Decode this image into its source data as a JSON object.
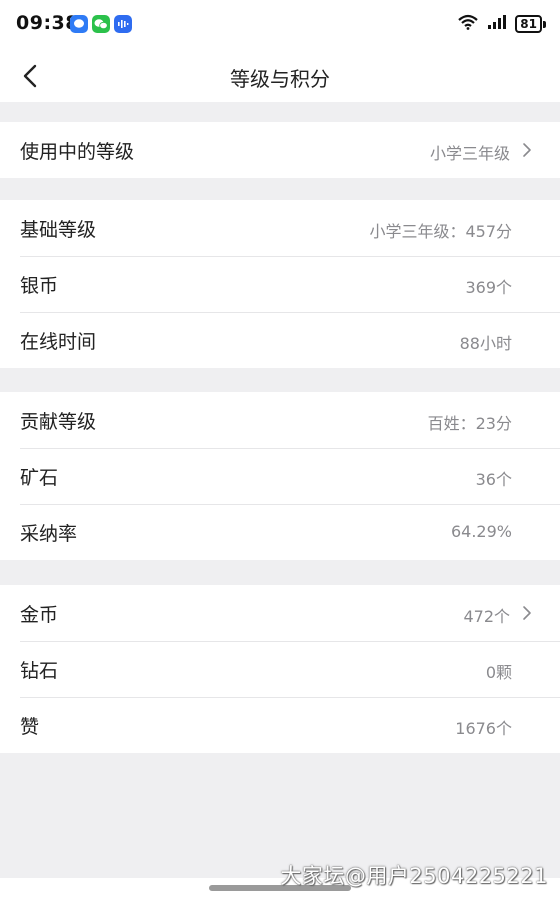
{
  "status_bar": {
    "time": "09:38",
    "battery": "81",
    "icons": [
      "message-icon",
      "wechat-icon",
      "voice-icon",
      "wifi-icon",
      "signal-icon",
      "battery-icon"
    ]
  },
  "nav": {
    "title": "等级与积分"
  },
  "sections": {
    "in_use": {
      "label": "使用中的等级",
      "value": "小学三年级"
    },
    "basic": {
      "level_label": "基础等级",
      "level_value": "小学三年级：457分",
      "silver_label": "银币",
      "silver_value": "369个",
      "online_label": "在线时间",
      "online_value": "88小时"
    },
    "contribution": {
      "level_label": "贡献等级",
      "level_value": "百姓：23分",
      "ore_label": "矿石",
      "ore_value": "36个",
      "adopt_label": "采纳率",
      "adopt_value": "64.29%"
    },
    "wealth": {
      "gold_label": "金币",
      "gold_value": "472个",
      "diamond_label": "钻石",
      "diamond_value": "0颗",
      "like_label": "赞",
      "like_value": "1676个"
    }
  },
  "watermark": "大家坛@用户2504225221",
  "colors": {
    "background": "#efeff1",
    "card": "#ffffff",
    "value_text": "#8a8a8e",
    "label_text": "#222222"
  }
}
